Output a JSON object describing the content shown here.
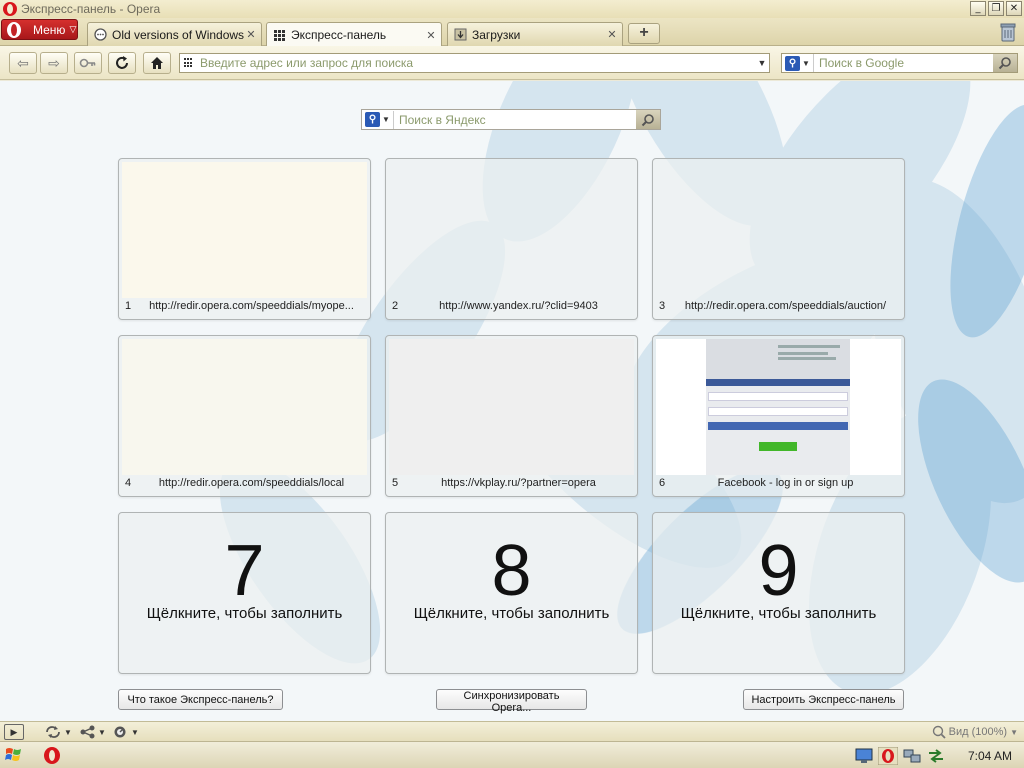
{
  "window": {
    "title": "Экспресс-панель - Opera"
  },
  "menu": {
    "label": "Меню"
  },
  "tabs": [
    {
      "label": "Old versions of Windows,...",
      "active": false,
      "icon": "chat-bubble-icon"
    },
    {
      "label": "Экспресс-панель",
      "active": true,
      "icon": "grid-icon"
    },
    {
      "label": "Загрузки",
      "active": false,
      "icon": "download-icon"
    }
  ],
  "address": {
    "placeholder": "Введите адрес или запрос для поиска",
    "value": ""
  },
  "google_search": {
    "placeholder": "Поиск в Google"
  },
  "yandex_search": {
    "placeholder": "Поиск в Яндекс"
  },
  "speed_dial": {
    "tiles": [
      {
        "num": "1",
        "url": "http://redir.opera.com/speeddials/myope..."
      },
      {
        "num": "2",
        "url": "http://www.yandex.ru/?clid=9403"
      },
      {
        "num": "3",
        "url": "http://redir.opera.com/speeddials/auction/"
      },
      {
        "num": "4",
        "url": "http://redir.opera.com/speeddials/local"
      },
      {
        "num": "5",
        "url": "https://vkplay.ru/?partner=opera"
      },
      {
        "num": "6",
        "url": "Facebook - log in or sign up"
      }
    ],
    "empty_tiles": [
      {
        "num": "7",
        "hint": "Щёлкните, чтобы заполнить"
      },
      {
        "num": "8",
        "hint": "Щёлкните, чтобы заполнить"
      },
      {
        "num": "9",
        "hint": "Щёлкните, чтобы заполнить"
      }
    ],
    "buttons": {
      "what": "Что такое Экспресс-панель?",
      "sync": "Синхронизировать Opera...",
      "configure": "Настроить Экспресс-панель"
    }
  },
  "statusbar": {
    "zoom": "Вид (100%)"
  },
  "taskbar": {
    "clock": "7:04 AM"
  },
  "colors": {
    "opera_red": "#d8161c",
    "accent_blue": "#2b5ab5",
    "facebook_blue": "#3b5998"
  }
}
